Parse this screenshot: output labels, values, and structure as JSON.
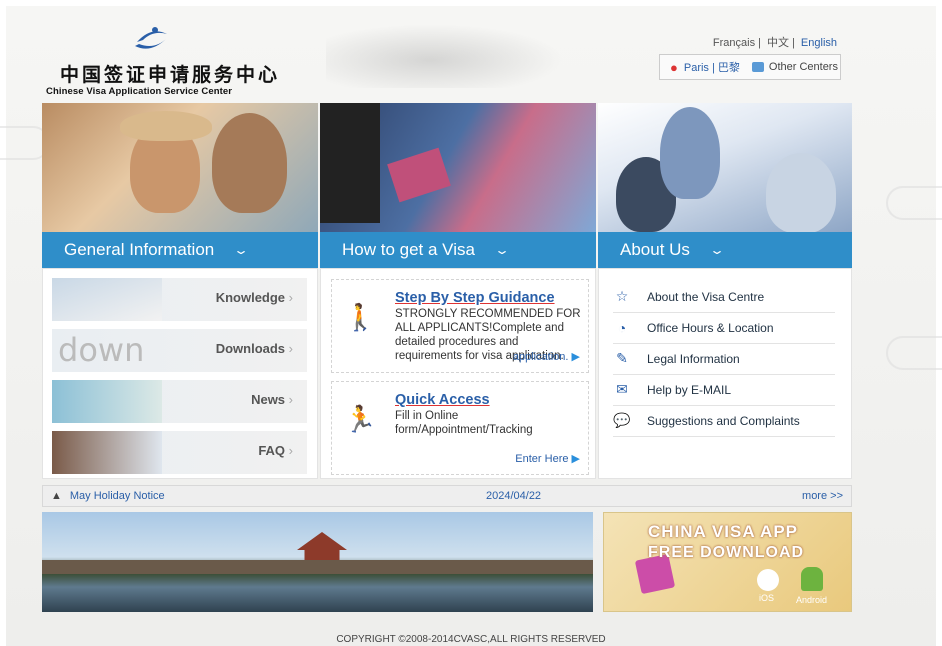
{
  "header": {
    "logo_cn": "中国签证申请服务中心",
    "logo_en": "Chinese Visa Application Service Center",
    "languages": [
      "Français",
      "中文",
      "English"
    ],
    "active_language": "English",
    "current_center": "Paris | 巴黎",
    "other_centers": "Other Centers"
  },
  "panels": [
    {
      "title": "General Information"
    },
    {
      "title": "How to get a Visa"
    },
    {
      "title": "About Us"
    }
  ],
  "general_info": {
    "items": [
      {
        "label": "Knowledge"
      },
      {
        "label": "Downloads"
      },
      {
        "label": "News"
      },
      {
        "label": "FAQ"
      }
    ]
  },
  "how_to": {
    "step": {
      "title": "Step By Step Guidance",
      "text": "STRONGLY RECOMMENDED FOR ALL APPLICANTS!Complete and detailed procedures and requirements for visa application.",
      "more": "application."
    },
    "quick": {
      "title": "Quick Access",
      "text": "Fill in Online form/Appointment/Tracking",
      "more": "Enter Here"
    }
  },
  "about_us": {
    "items": [
      {
        "label": "About the Visa Centre",
        "icon": "star-icon"
      },
      {
        "label": "Office Hours & Location",
        "icon": "clock-icon"
      },
      {
        "label": "Legal Information",
        "icon": "pen-icon"
      },
      {
        "label": "Help by E-MAIL",
        "icon": "mail-icon"
      },
      {
        "label": "Suggestions and Complaints",
        "icon": "speech-bubble-icon"
      }
    ]
  },
  "notice": {
    "title": "May Holiday Notice",
    "date": "2024/04/22",
    "more": "more >>"
  },
  "app_banner": {
    "line1": "CHINA VISA APP",
    "line2": "FREE DOWNLOAD",
    "ios": "iOS",
    "android": "Android"
  },
  "footer": {
    "copyright": "COPYRIGHT ©2008-2014CVASC,ALL RIGHTS RESERVED"
  },
  "colors": {
    "accent_blue": "#2f8ec9",
    "link_blue": "#2a5fa8",
    "underline_red": "#d33333"
  }
}
